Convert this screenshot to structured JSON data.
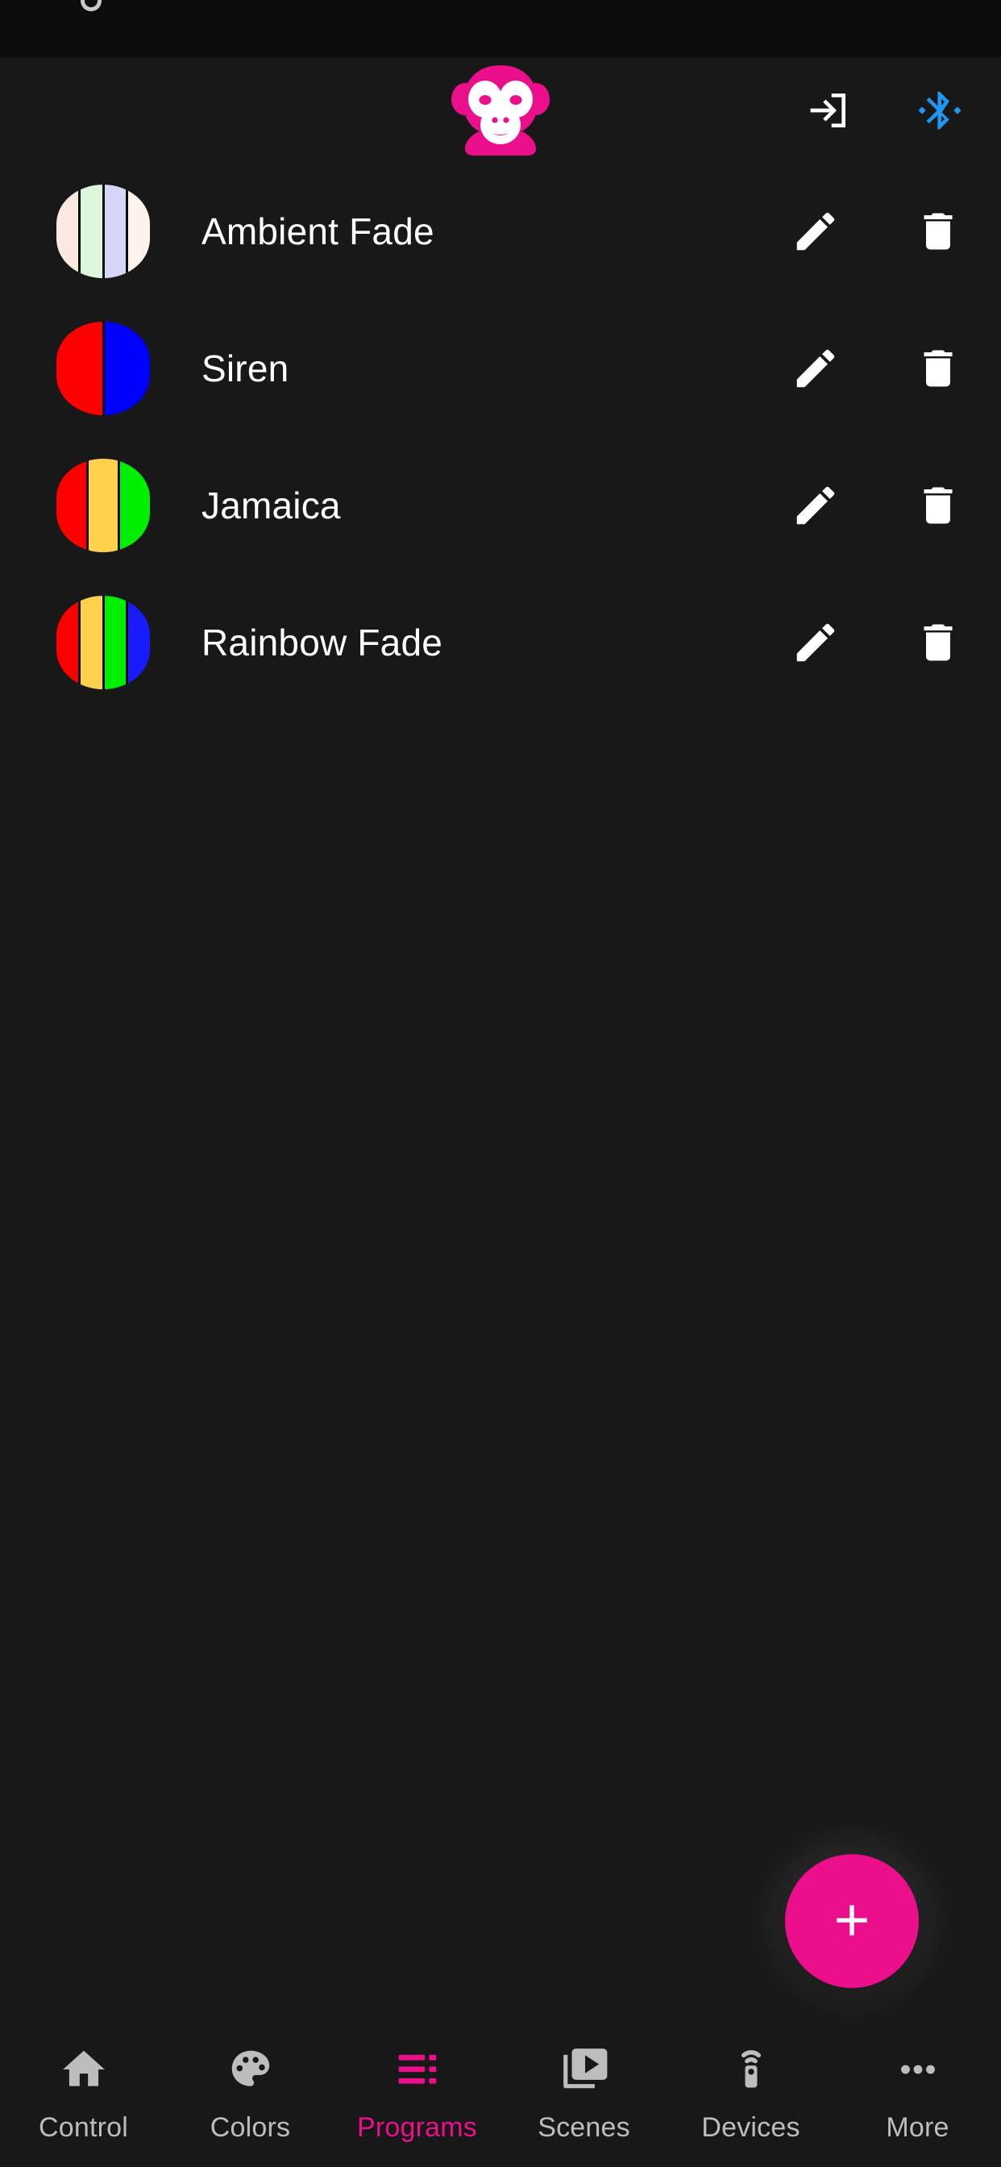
{
  "app": {
    "screen_title": "Programs",
    "background": "#181818",
    "accent": "#ec0f8c",
    "logo_icon": "monkey-logo-icon",
    "logo_color": "#ec0f8c",
    "logo_face_color": "#ffffff"
  },
  "appbar": {
    "actions": [
      {
        "name": "login-icon",
        "label": "Login",
        "color": "#ffffff"
      },
      {
        "name": "bluetooth-icon",
        "label": "Bluetooth",
        "color": "#2196f3"
      }
    ]
  },
  "programs": [
    {
      "name": "Ambient Fade",
      "colors": [
        "#fae9e0",
        "#ddf7dd",
        "#d6d6fb",
        "#fdf2ec"
      ],
      "edit_label": "Edit",
      "delete_label": "Delete"
    },
    {
      "name": "Siren",
      "colors": [
        "#ff0000",
        "#0000ff"
      ],
      "edit_label": "Edit",
      "delete_label": "Delete"
    },
    {
      "name": "Jamaica",
      "colors": [
        "#ff0000",
        "#ffd14d",
        "#00ee00"
      ],
      "edit_label": "Edit",
      "delete_label": "Delete"
    },
    {
      "name": "Rainbow Fade",
      "colors": [
        "#ff0000",
        "#ffd14d",
        "#00ee00",
        "#1a1aff"
      ],
      "edit_label": "Edit",
      "delete_label": "Delete"
    }
  ],
  "fab": {
    "label": "+",
    "action_name": "Add program",
    "color": "#ec0f8c"
  },
  "bottom_nav": {
    "items": [
      {
        "label": "Control",
        "icon": "home-icon",
        "active": false
      },
      {
        "label": "Colors",
        "icon": "palette-icon",
        "active": false
      },
      {
        "label": "Programs",
        "icon": "playlist-icon",
        "active": true
      },
      {
        "label": "Scenes",
        "icon": "video-library-icon",
        "active": false
      },
      {
        "label": "Devices",
        "icon": "remote-icon",
        "active": false
      },
      {
        "label": "More",
        "icon": "more-horizontal-icon",
        "active": false
      }
    ]
  }
}
